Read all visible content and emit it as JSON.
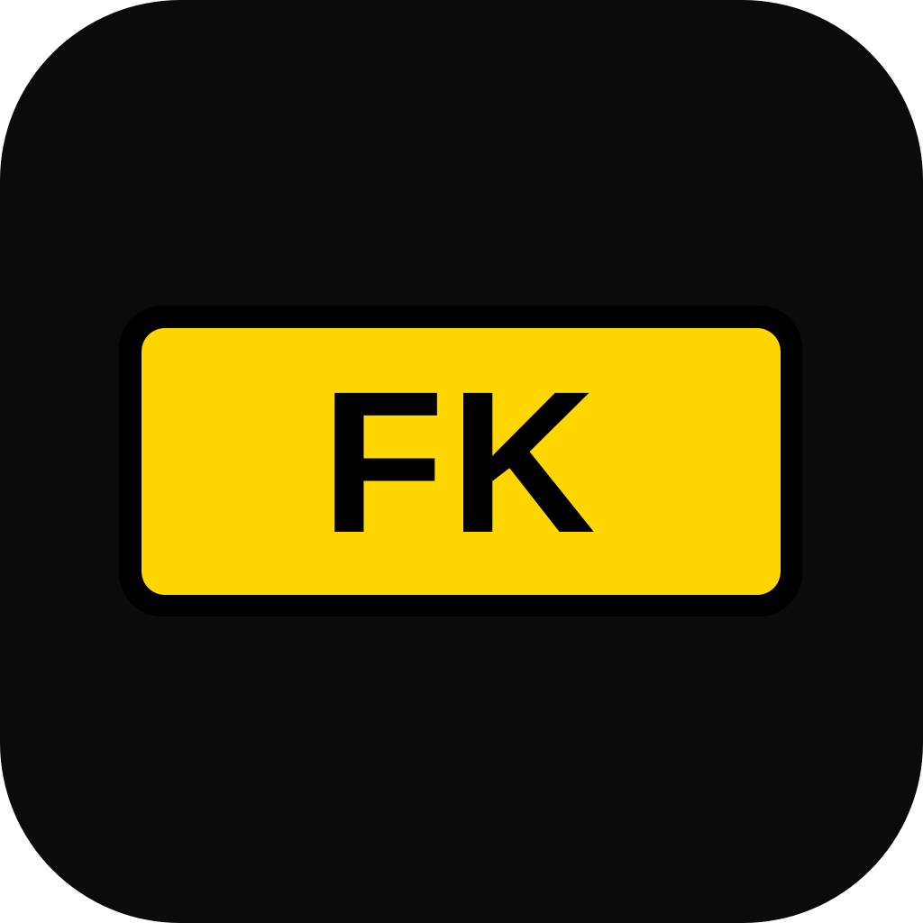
{
  "app_icon": {
    "background_color": "#0b0b0b",
    "badge": {
      "text": "FK",
      "fill_color": "#ffd600",
      "outline_color": "#000000",
      "text_color": "#000000"
    }
  }
}
